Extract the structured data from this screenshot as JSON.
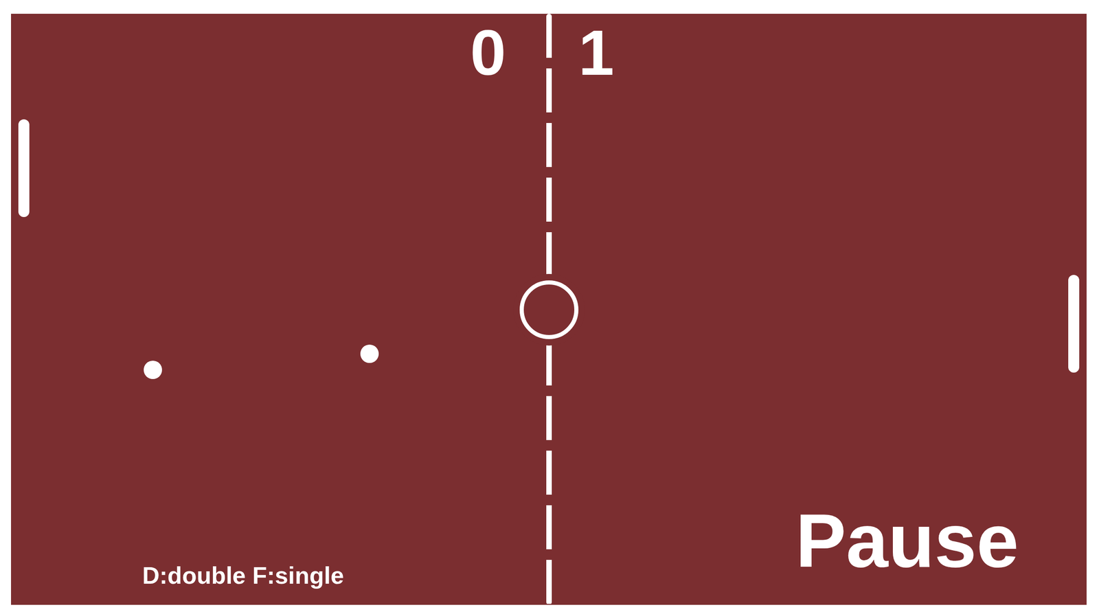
{
  "scoreboard": {
    "left": "0",
    "right": "1"
  },
  "status": "Pause",
  "hint": "D:double F:single"
}
